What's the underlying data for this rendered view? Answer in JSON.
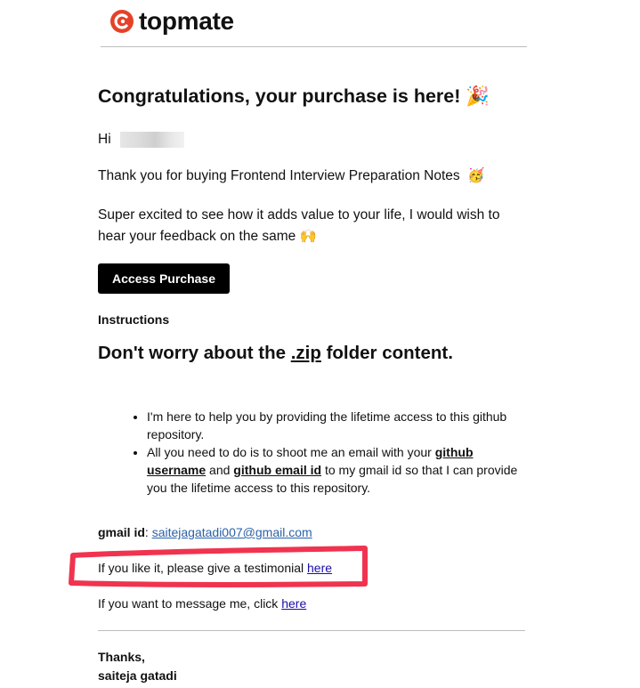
{
  "brand": {
    "name": "topmate",
    "color": "#e5412a",
    "icon": "topmate-logo-icon"
  },
  "heading": "Congratulations, your purchase is here!",
  "heading_emoji": "🎉",
  "greeting": "Hi",
  "thank_you": "Thank you for buying Frontend Interview Preparation Notes",
  "thank_you_emoji": "🥳",
  "message_line1": "Super excited to see how it adds value to your life, I would wish to",
  "message_line2": "hear your feedback on the same",
  "message_emoji": "🙌",
  "access_button": "Access Purchase",
  "instructions_label": "Instructions",
  "subheading": {
    "pre": "Don't worry about the ",
    "zip": ".zip",
    "post": " folder content."
  },
  "bullets": {
    "b1_line1": "I'm here to help you by providing the lifetime access to this github",
    "b1_line2": "repository.",
    "b2_pre": "All you need to do is to shoot me an email with your ",
    "b2_github": "github",
    "b2_username": "username",
    "b2_and": " and ",
    "b2_email": "github email id",
    "b2_post": " to my gmail id so that I can provide",
    "b2_line3": "you the lifetime access to this repository."
  },
  "gmail": {
    "label": "gmail id",
    "sep": ": ",
    "value": "saitejagatadi007@gmail.com"
  },
  "testimonial": {
    "text": "If you like it, please give a testimonial ",
    "link": "here"
  },
  "message_me": {
    "text": "If you want to message me, click ",
    "link": "here"
  },
  "signoff": {
    "thanks": "Thanks,",
    "name": "saiteja gatadi"
  },
  "colors": {
    "highlight": "#f0334f",
    "button": "#000000",
    "link": "#1a0dab"
  }
}
